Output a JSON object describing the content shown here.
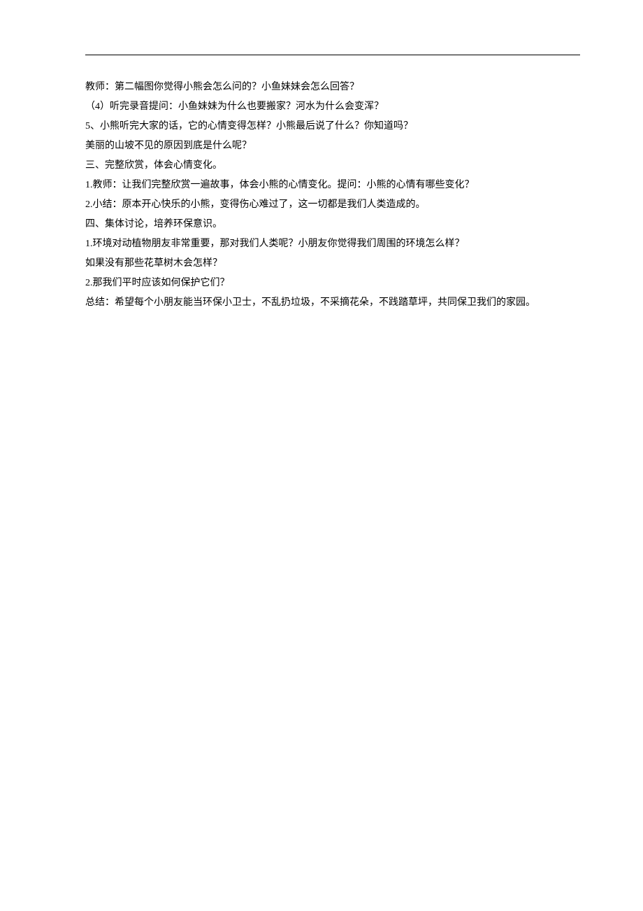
{
  "lines": [
    "教师：第二幅图你觉得小熊会怎么问的？小鱼妹妹会怎么回答？",
    "（4）听完录音提问：小鱼妹妹为什么也要搬家？河水为什么会变浑？",
    "5、小熊听完大家的话，它的心情变得怎样？小熊最后说了什么？你知道吗？",
    "美丽的山坡不见的原因到底是什么呢？",
    " 三、完整欣赏，体会心情变化。",
    "1.教师：让我们完整欣赏一遍故事，体会小熊的心情变化。提问：小熊的心情有哪些变化？",
    "2.小结：原本开心快乐的小熊，变得伤心难过了，这一切都是我们人类造成的。",
    "四、集体讨论，培养环保意识。",
    "1.环境对动植物朋友非常重要，那对我们人类呢？小朋友你觉得我们周围的环境怎么样？",
    "如果没有那些花草树木会怎样？",
    "2.那我们平时应该如何保护它们？",
    "总结：希望每个小朋友能当环保小卫士，不乱扔垃圾，不采摘花朵，不践踏草坪，共同保卫我们的家园。"
  ]
}
